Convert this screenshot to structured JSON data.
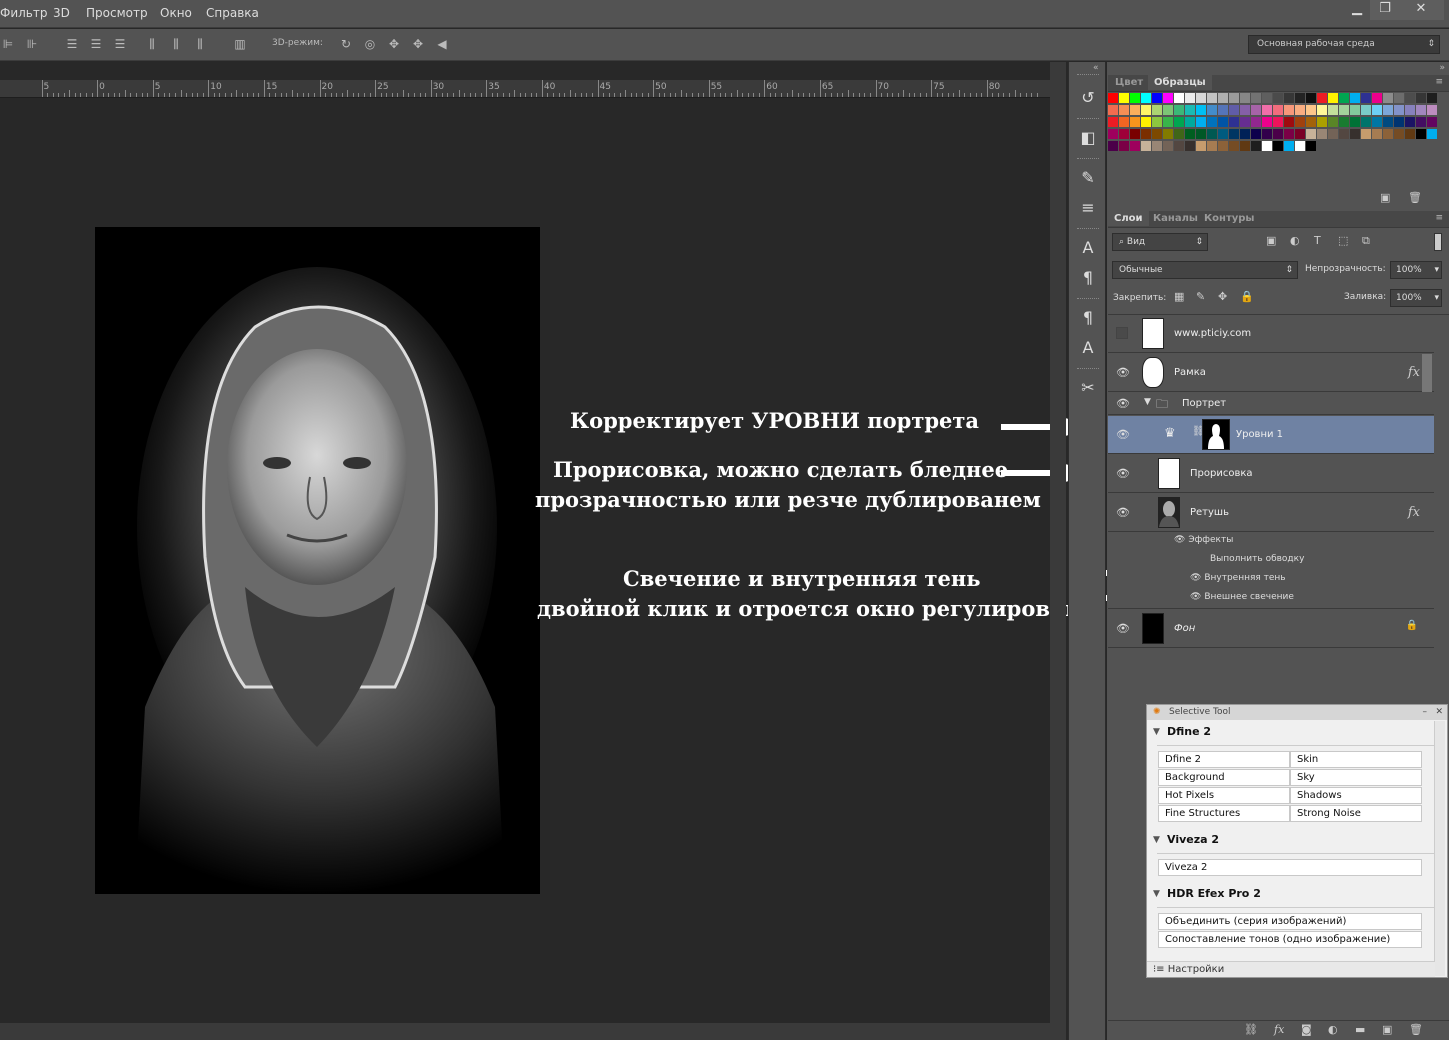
{
  "menu": {
    "items": [
      "Фильтр",
      "3D",
      "Просмотр",
      "Окно",
      "Справка"
    ]
  },
  "window_controls": {
    "minimize": "▁",
    "restore": "❐",
    "close": "✕"
  },
  "options_bar": {
    "mode_label": "3D-режим:",
    "workspace": "Основная рабочая среда"
  },
  "ruler": {
    "labels": [
      "5",
      "0",
      "5",
      "10",
      "15",
      "20",
      "25",
      "30",
      "35",
      "40",
      "45",
      "50",
      "55",
      "60",
      "65",
      "70",
      "75",
      "80"
    ]
  },
  "annotations": {
    "levels": "Корректирует УРОВНИ портрета",
    "drawing_line1": "Прорисовка, можно сделать бледнее",
    "drawing_line2": "прозрачностью или резче дублированем",
    "glow_line1": "Свечение и внутренняя тень",
    "glow_line2": "двойной клик и отроется окно регулировки"
  },
  "swatch_panel": {
    "tabs": [
      "Цвет",
      "Образцы"
    ],
    "colors": [
      [
        "#ff0000",
        "#ffff00",
        "#00ff00",
        "#00ffff",
        "#0000ff",
        "#ff00ff",
        "#ffffff",
        "#ebebeb",
        "#d7d7d7",
        "#c3c3c3",
        "#afafaf",
        "#9b9b9b",
        "#878787",
        "#737373",
        "#5f5f5f",
        "#4b4b4b",
        "#373737",
        "#232323",
        "#0f0f0f",
        "#ed1c24",
        "#fff200",
        "#00a651",
        "#00aeef",
        "#2e3192",
        "#ec008c",
        "#8c8c8c",
        "#6d6d6d",
        "#4d4d4d",
        "#363636",
        "#1e1e1e"
      ],
      [
        "#f26c4f",
        "#f68e55",
        "#fbaf5c",
        "#fff467",
        "#acd372",
        "#7cc576",
        "#3bb878",
        "#1abbb4",
        "#00bff3",
        "#438cca",
        "#5574b9",
        "#605ca8",
        "#855fa8",
        "#a763a8",
        "#f06ea9",
        "#f26d7d",
        "#f7977a",
        "#f9ad81",
        "#fdc68a",
        "#fff799",
        "#c4df9b",
        "#a3d39c",
        "#82ca9d",
        "#7accc8",
        "#6dcff6",
        "#7da7d9",
        "#8393ca",
        "#8781bd",
        "#a186be",
        "#bd8cbf"
      ],
      [
        "#ed1c24",
        "#f26522",
        "#f7941d",
        "#fff200",
        "#8dc63f",
        "#39b54a",
        "#00a651",
        "#00a99d",
        "#00aeef",
        "#0072bc",
        "#0054a6",
        "#2e3192",
        "#662d91",
        "#92278f",
        "#ec008c",
        "#ed145b",
        "#9e0b0f",
        "#a0410d",
        "#a3620a",
        "#aba000",
        "#598527",
        "#197b30",
        "#007236",
        "#00746b",
        "#0076a3",
        "#004a80",
        "#003471",
        "#1b1464",
        "#440e62",
        "#630460"
      ],
      [
        "#9e005d",
        "#9e0039",
        "#790000",
        "#7b2e00",
        "#7d4900",
        "#827b00",
        "#406618",
        "#005e20",
        "#005826",
        "#005952",
        "#005b7f",
        "#003663",
        "#002157",
        "#0d004c",
        "#32004b",
        "#4b0049",
        "#7b0046",
        "#7a0026",
        "#c7b299",
        "#998675",
        "#736357",
        "#534741",
        "#37302d",
        "#c69c6d",
        "#a67c52",
        "#8c6239",
        "#754c24",
        "#603913",
        "#000000",
        "#00aeef"
      ]
    ],
    "extra_row": [
      "#1e1e1e",
      "#ffffff",
      "#000000",
      "#00aeef",
      "#ffffff",
      "#000000"
    ]
  },
  "layers_panel": {
    "tabs": [
      "Слои",
      "Каналы",
      "Контуры"
    ],
    "filter_kind": "Вид",
    "blend_mode": "Обычные",
    "opacity_label": "Непрозрачность:",
    "opacity_value": "100%",
    "lock_label": "Закрепить:",
    "fill_label": "Заливка:",
    "fill_value": "100%",
    "layers": [
      {
        "name": "www.pticiy.com"
      },
      {
        "name": "Рамка"
      },
      {
        "name": "Портрет"
      },
      {
        "name": "Уровни 1"
      },
      {
        "name": "Прорисовка"
      },
      {
        "name": "Ретушь"
      },
      {
        "name": "Фон"
      }
    ],
    "effects": {
      "header": "Эффекты",
      "items": [
        "Выполнить обводку",
        "Внутренняя тень",
        "Внешнее свечение"
      ]
    },
    "fx_label": "fx",
    "bottom_icons": [
      "link-icon",
      "fx-icon",
      "mask-icon",
      "adjustment-icon",
      "folder-icon",
      "new-layer-icon",
      "trash-icon"
    ]
  },
  "selective_tool": {
    "title": "Selective Tool",
    "sections": [
      {
        "name": "Dfine 2",
        "items": [
          "Dfine 2",
          "Skin",
          "Background",
          "Sky",
          "Hot Pixels",
          "Shadows",
          "Fine Structures",
          "Strong Noise"
        ]
      },
      {
        "name": "Viveza 2",
        "items": [
          "Viveza 2"
        ]
      },
      {
        "name": "HDR Efex Pro 2",
        "items": [
          "Объединить (серия изображений)",
          "Сопоставление тонов (одно изображение)"
        ]
      }
    ],
    "settings": "Настройки"
  }
}
